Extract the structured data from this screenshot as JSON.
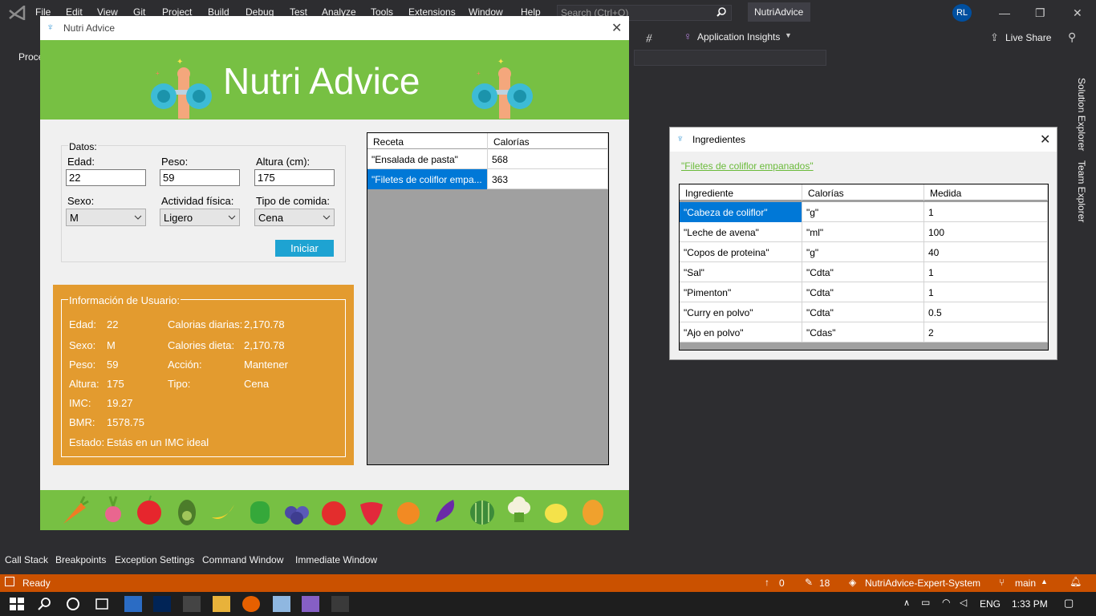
{
  "vs": {
    "menu": [
      "File",
      "Edit",
      "View",
      "Git",
      "Project",
      "Build",
      "Debug",
      "Test",
      "Analyze",
      "Tools",
      "Extensions",
      "Window",
      "Help"
    ],
    "search_placeholder": "Search (Ctrl+Q)",
    "solution_name": "NutriAdvice",
    "avatar_initials": "RL",
    "toolbar_proc": "Proce",
    "app_insights": "Application Insights",
    "live_share": "Live Share",
    "solution_explorer": "Solution Explorer",
    "team_explorer": "Team Explorer",
    "bottom_tabs": [
      "Call Stack",
      "Breakpoints",
      "Exception Settings",
      "Command Window",
      "Immediate Window"
    ],
    "status": {
      "ready": "Ready",
      "up_count": "0",
      "edit_count": "18",
      "repo": "NutriAdvice-Expert-System",
      "branch": "main"
    },
    "taskbar": {
      "lang": "ENG",
      "time": "1:33 PM"
    },
    "colors": {
      "status_bar": "#ca5100",
      "menu_bg": "#2d2d30"
    }
  },
  "nutri": {
    "window_title": "Nutri Advice",
    "banner_title": "Nutri Advice",
    "datos_legend": "Datos:",
    "labels": {
      "edad": "Edad:",
      "peso": "Peso:",
      "altura": "Altura (cm):",
      "sexo": "Sexo:",
      "actividad": "Actividad física:",
      "tipo": "Tipo de comida:"
    },
    "values": {
      "edad": "22",
      "peso": "59",
      "altura": "175",
      "sexo": "M",
      "actividad": "Ligero",
      "tipo": "Cena"
    },
    "iniciar_label": "Iniciar",
    "info": {
      "legend": "Información de Usuario:",
      "left": [
        [
          "Edad:",
          "22"
        ],
        [
          "Sexo:",
          "M"
        ],
        [
          "Peso:",
          "59"
        ],
        [
          "Altura:",
          "175"
        ],
        [
          "IMC:",
          "19.27"
        ],
        [
          "BMR:",
          "1578.75"
        ],
        [
          "Estado:",
          "Estás en un IMC ideal"
        ]
      ],
      "right": [
        [
          "Calorias diarias:",
          "2,170.78"
        ],
        [
          "Calories dieta:",
          "2,170.78"
        ],
        [
          "Acción:",
          "Mantener"
        ],
        [
          "Tipo:",
          "Cena"
        ]
      ]
    },
    "recetas": {
      "headers": [
        "Receta",
        "Calorías"
      ],
      "rows": [
        [
          "\"Ensalada de pasta\"",
          "568"
        ],
        [
          "\"Filetes de coliflor empa...",
          "363"
        ]
      ]
    },
    "colors": {
      "banner": "#77c043",
      "info_panel": "#e39b2f",
      "button": "#1ea3d2",
      "selection": "#0078d7"
    }
  },
  "ingredientes": {
    "window_title": "Ingredientes",
    "link": "\"Filetes de coliflor empanados\"",
    "headers": [
      "Ingrediente",
      "Calorías",
      "Medida"
    ],
    "rows": [
      [
        "\"Cabeza de coliflor\"",
        "\"g\"",
        "1"
      ],
      [
        "\"Leche de avena\"",
        "\"ml\"",
        "100"
      ],
      [
        "\"Copos de proteina\"",
        "\"g\"",
        "40"
      ],
      [
        "\"Sal\"",
        "\"Cdta\"",
        "1"
      ],
      [
        "\"Pimenton\"",
        "\"Cdta\"",
        "1"
      ],
      [
        "\"Curry en polvo\"",
        "\"Cdta\"",
        "0.5"
      ],
      [
        "\"Ajo en polvo\"",
        "\"Cdas\"",
        "2"
      ]
    ]
  }
}
